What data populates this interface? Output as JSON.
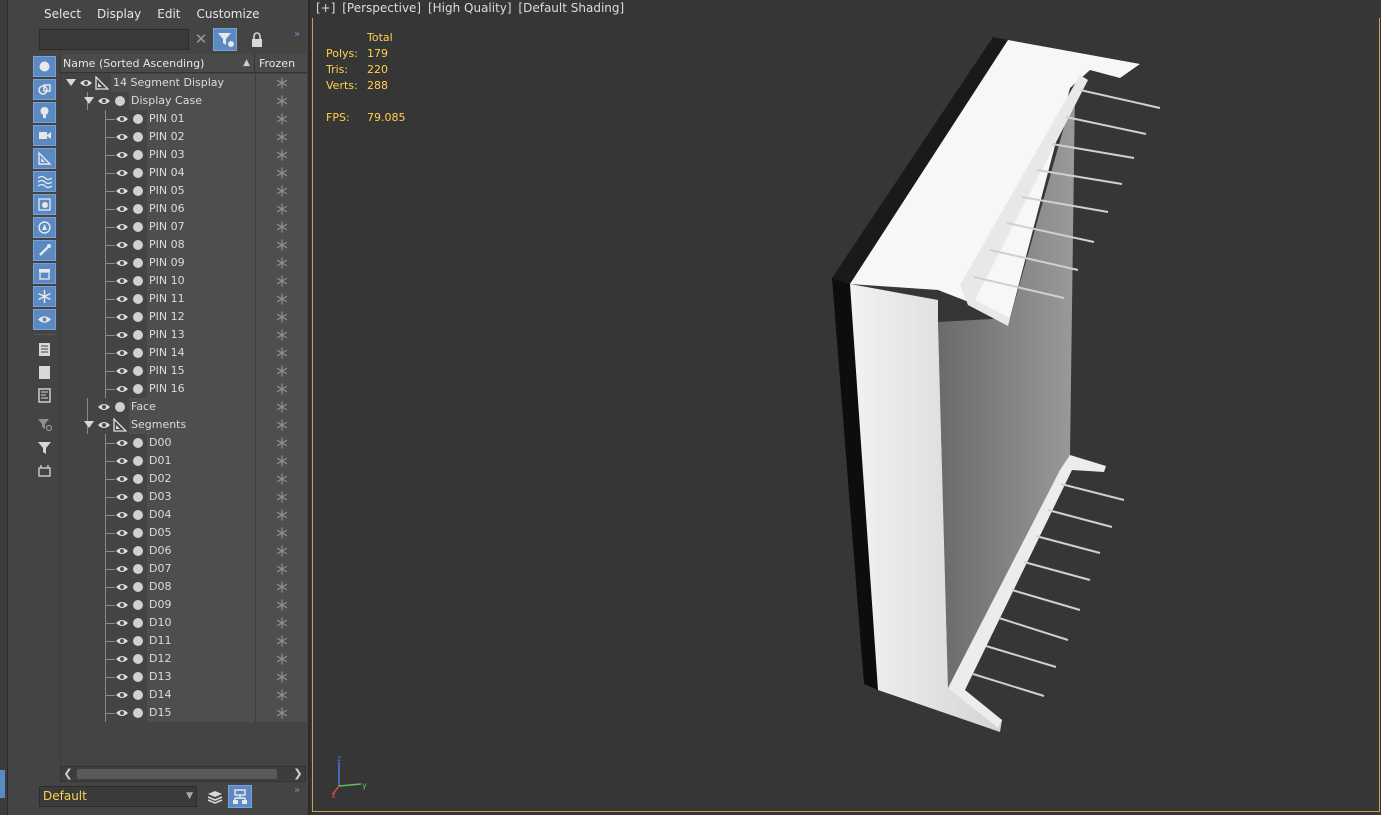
{
  "menu": [
    "Select",
    "Display",
    "Edit",
    "Customize"
  ],
  "search": {
    "value": "",
    "placeholder": ""
  },
  "columns": {
    "name": "Name (Sorted Ascending)",
    "sort_indicator": "▲",
    "frozen": "Frozen"
  },
  "tree": [
    {
      "label": "14 Segment Display",
      "depth": 0,
      "type": "helper",
      "expanded": true
    },
    {
      "label": "Display Case",
      "depth": 1,
      "type": "object",
      "expanded": true
    },
    {
      "label": "PIN 01",
      "depth": 2,
      "type": "object"
    },
    {
      "label": "PIN 02",
      "depth": 2,
      "type": "object"
    },
    {
      "label": "PIN 03",
      "depth": 2,
      "type": "object"
    },
    {
      "label": "PIN 04",
      "depth": 2,
      "type": "object"
    },
    {
      "label": "PIN 05",
      "depth": 2,
      "type": "object"
    },
    {
      "label": "PIN 06",
      "depth": 2,
      "type": "object"
    },
    {
      "label": "PIN 07",
      "depth": 2,
      "type": "object"
    },
    {
      "label": "PIN 08",
      "depth": 2,
      "type": "object"
    },
    {
      "label": "PIN 09",
      "depth": 2,
      "type": "object"
    },
    {
      "label": "PIN 10",
      "depth": 2,
      "type": "object"
    },
    {
      "label": "PIN 11",
      "depth": 2,
      "type": "object"
    },
    {
      "label": "PIN 12",
      "depth": 2,
      "type": "object"
    },
    {
      "label": "PIN 13",
      "depth": 2,
      "type": "object"
    },
    {
      "label": "PIN 14",
      "depth": 2,
      "type": "object"
    },
    {
      "label": "PIN 15",
      "depth": 2,
      "type": "object"
    },
    {
      "label": "PIN 16",
      "depth": 2,
      "type": "object"
    },
    {
      "label": "Face",
      "depth": 1,
      "type": "object"
    },
    {
      "label": "Segments",
      "depth": 1,
      "type": "helper",
      "expanded": true
    },
    {
      "label": "D00",
      "depth": 2,
      "type": "object"
    },
    {
      "label": "D01",
      "depth": 2,
      "type": "object"
    },
    {
      "label": "D02",
      "depth": 2,
      "type": "object"
    },
    {
      "label": "D03",
      "depth": 2,
      "type": "object"
    },
    {
      "label": "D04",
      "depth": 2,
      "type": "object"
    },
    {
      "label": "D05",
      "depth": 2,
      "type": "object"
    },
    {
      "label": "D06",
      "depth": 2,
      "type": "object"
    },
    {
      "label": "D07",
      "depth": 2,
      "type": "object"
    },
    {
      "label": "D08",
      "depth": 2,
      "type": "object"
    },
    {
      "label": "D09",
      "depth": 2,
      "type": "object"
    },
    {
      "label": "D10",
      "depth": 2,
      "type": "object"
    },
    {
      "label": "D11",
      "depth": 2,
      "type": "object"
    },
    {
      "label": "D12",
      "depth": 2,
      "type": "object"
    },
    {
      "label": "D13",
      "depth": 2,
      "type": "object"
    },
    {
      "label": "D14",
      "depth": 2,
      "type": "object"
    },
    {
      "label": "D15",
      "depth": 2,
      "type": "object"
    }
  ],
  "toolbar_icons": [
    "geometry-icon",
    "shapes-icon",
    "lights-icon",
    "cameras-icon",
    "helpers-icon",
    "space-warps-icon",
    "groups-icon",
    "xrefs-icon",
    "bones-icon",
    "containers-icon",
    "frozen-icon",
    "hidden-icon",
    "select-all-icon",
    "select-none-icon",
    "invert-selection-icon",
    "filter-settings-icon",
    "filter-icon",
    "sync-selection-icon"
  ],
  "bottom": {
    "layer": "Default"
  },
  "viewport": {
    "labels": [
      "[+]",
      "[Perspective]",
      "[High Quality]",
      "[Default Shading]"
    ],
    "stats": {
      "header": "Total",
      "rows": [
        {
          "key": "Polys:",
          "value": "179"
        },
        {
          "key": "Tris:",
          "value": "220"
        },
        {
          "key": "Verts:",
          "value": "288"
        }
      ],
      "fps_key": "FPS:",
      "fps_value": "79.085"
    },
    "axes": {
      "x": "x",
      "y": "y",
      "z": "z"
    }
  },
  "colors": {
    "accent": "#5b89c3",
    "stats_text": "#ffd24d",
    "viewport_border": "#c7a24a",
    "panel_bg": "#444444",
    "viewport_bg": "#363636"
  }
}
